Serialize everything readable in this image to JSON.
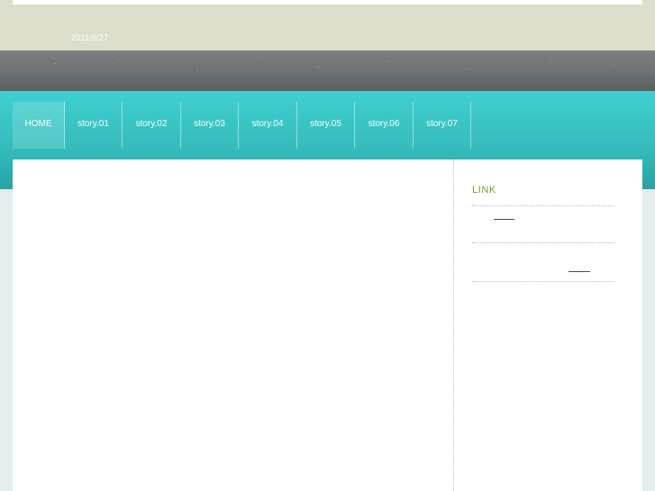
{
  "header": {
    "date": "2011/5/27"
  },
  "nav": {
    "items": [
      {
        "label": "HOME",
        "key": "home"
      },
      {
        "label": "story.01",
        "key": "story-01"
      },
      {
        "label": "story.02",
        "key": "story-02"
      },
      {
        "label": "story.03",
        "key": "story-03"
      },
      {
        "label": "story.04",
        "key": "story-04"
      },
      {
        "label": "story.05",
        "key": "story-05"
      },
      {
        "label": "story.06",
        "key": "story-06"
      },
      {
        "label": "story.07",
        "key": "story-07"
      }
    ]
  },
  "sidebar": {
    "heading": "LINK"
  },
  "colors": {
    "teal": "#36bdbd",
    "gray_band": "#6c7072",
    "top_band": "#dcdecb",
    "link_heading": "#6aa32a"
  }
}
